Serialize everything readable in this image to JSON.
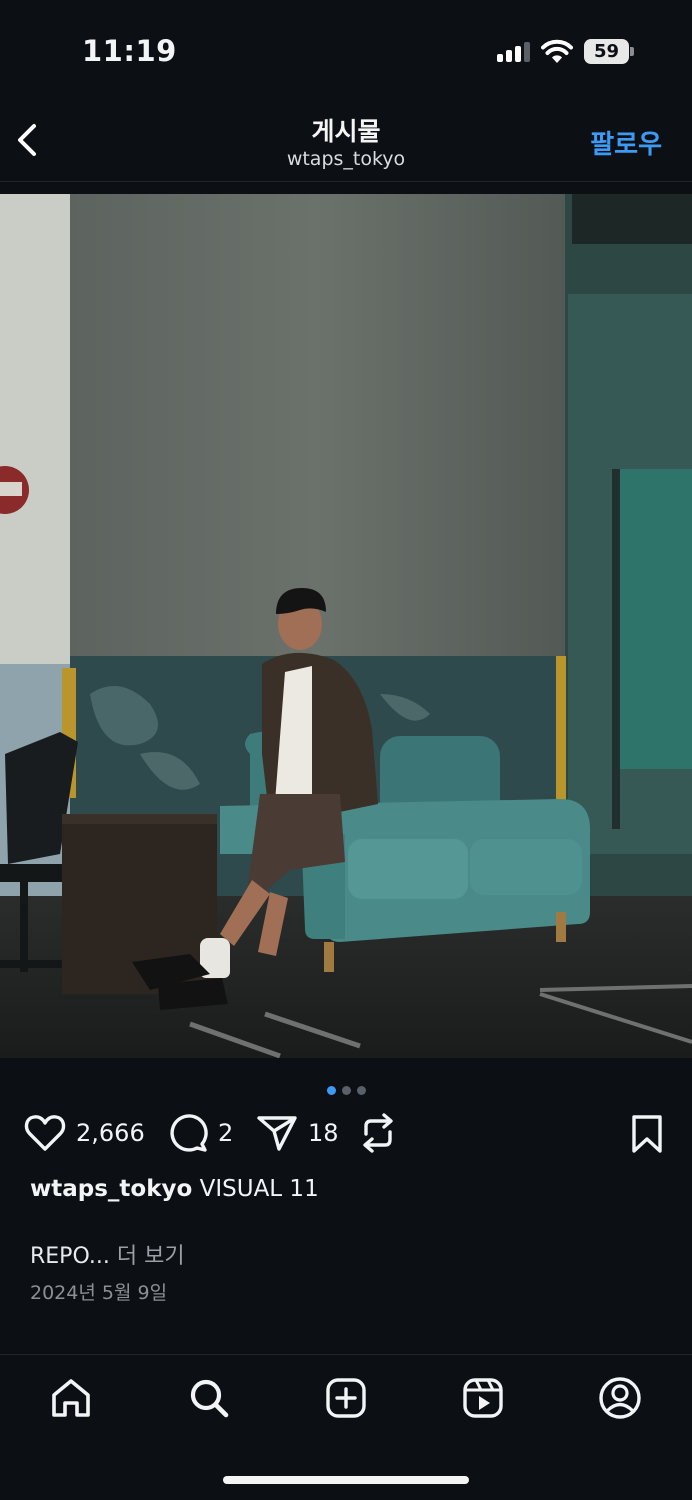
{
  "status_bar": {
    "time": "11:19",
    "battery": "59"
  },
  "header": {
    "title": "게시물",
    "username": "wtaps_tokyo",
    "follow_label": "팔로우"
  },
  "carousel": {
    "count": 3,
    "active": 1
  },
  "actions": {
    "likes": "2,666",
    "comments": "2",
    "shares": "18"
  },
  "caption": {
    "username": "wtaps_tokyo",
    "text": " VISUAL 11",
    "preview": "REPO... ",
    "more_label": "더 보기"
  },
  "date": "2024년 5월 9일",
  "colors": {
    "accent": "#3d9bf5",
    "background": "#0c1015"
  },
  "icons": [
    "back-chevron-icon",
    "heart-icon",
    "comment-icon",
    "share-icon",
    "repost-icon",
    "bookmark-icon",
    "home-icon",
    "search-icon",
    "create-icon",
    "reels-icon",
    "profile-icon"
  ]
}
